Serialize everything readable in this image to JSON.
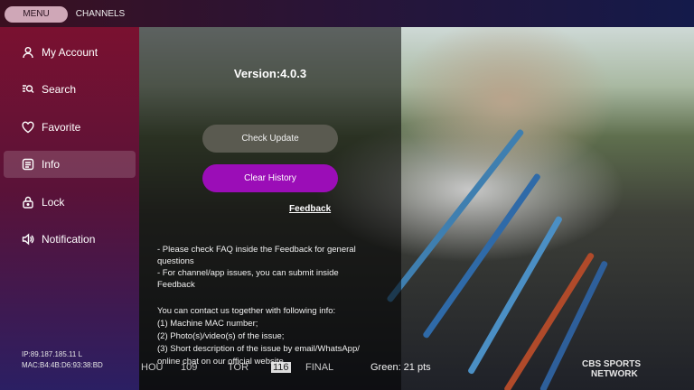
{
  "tabs": [
    {
      "label": "MENU"
    },
    {
      "label": "CHANNELS"
    }
  ],
  "sidebar": {
    "items": [
      {
        "label": "My Account",
        "icon": "person-icon"
      },
      {
        "label": "Search",
        "icon": "search-icon"
      },
      {
        "label": "Favorite",
        "icon": "heart-icon"
      },
      {
        "label": "Info",
        "icon": "info-icon",
        "active": true
      },
      {
        "label": "Lock",
        "icon": "lock-icon"
      },
      {
        "label": "Notification",
        "icon": "speaker-icon"
      }
    ],
    "ip": "IP:89.187.185.11 L",
    "mac": "MAC:B4:4B:D6:93:38:BD"
  },
  "info": {
    "version": "Version:4.0.3",
    "check_update_label": "Check Update",
    "clear_history_label": "Clear History",
    "feedback_label": "Feedback",
    "lines": [
      "- Please check FAQ inside the Feedback for general",
      "questions",
      "- For channel/app issues, you can submit inside",
      "Feedback",
      "",
      "You can contact us together with following info:",
      "(1) Machine MAC number;",
      "(2) Photo(s)/video(s) of the issue;",
      "(3) Short description of the issue by email/WhatsApp/",
      "online chat on our official website."
    ]
  },
  "video": {
    "ticker": {
      "team1": "HOU",
      "score1": "109",
      "team2": "TOR",
      "score2": "116",
      "status": "FINAL",
      "stat": "Green: 21 pts"
    },
    "network_line1": "CBS SPORTS",
    "network_line2": "NETWORK"
  },
  "colors": {
    "accent_purple": "#9b0db7",
    "sidebar_top": "#7a1130",
    "sidebar_bottom": "#2b1f63"
  }
}
